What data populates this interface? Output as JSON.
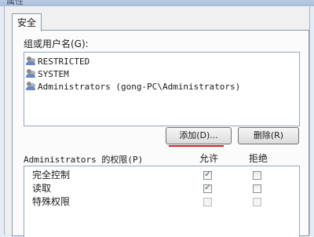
{
  "window": {
    "title": "属性"
  },
  "tabs": [
    {
      "label": "安全"
    }
  ],
  "group_list": {
    "label": "组或用户名(G):",
    "items": [
      {
        "text": "RESTRICTED",
        "icon": "users-icon"
      },
      {
        "text": "SYSTEM",
        "icon": "users-icon"
      },
      {
        "text": "Administrators (gong-PC\\Administrators)",
        "icon": "users-icon"
      }
    ]
  },
  "buttons": {
    "add_label": "添加(D)...",
    "remove_label": "删除(R)"
  },
  "permissions": {
    "label": "Administrators 的权限(P)",
    "allow_header": "允许",
    "deny_header": "拒绝",
    "rows": [
      {
        "name": "完全控制",
        "allow": true,
        "deny": false,
        "enabled": true
      },
      {
        "name": "读取",
        "allow": true,
        "deny": false,
        "enabled": true
      },
      {
        "name": "特殊权限",
        "allow": false,
        "deny": false,
        "enabled": false
      }
    ]
  },
  "colors": {
    "highlight_underline": "#d6202a",
    "dialog_bg": "#f0f0f0"
  }
}
